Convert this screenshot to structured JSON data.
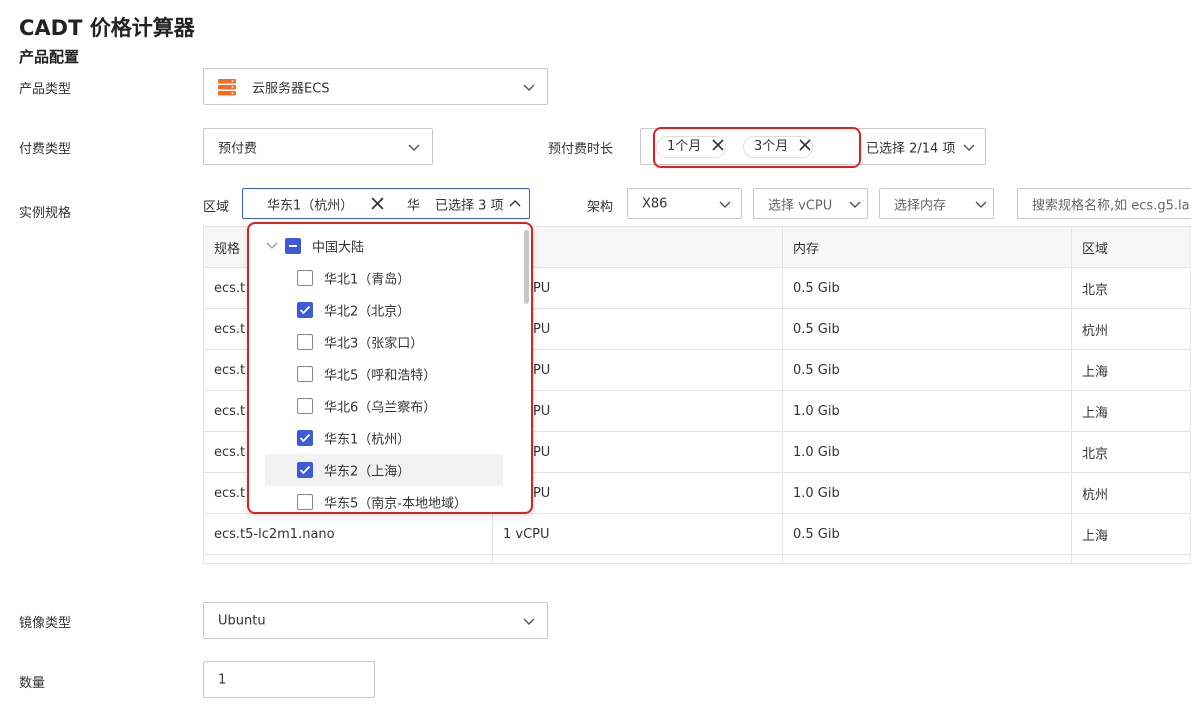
{
  "app_title": "CADT 价格计算器",
  "section_title": "产品配置",
  "product_type": {
    "label": "产品类型",
    "value": "云服务器ECS",
    "icon": "ecs-server-icon",
    "icon_color": "#f36d21"
  },
  "billing": {
    "label": "付费类型",
    "value": "预付费",
    "duration_label": "预付费时长",
    "tags": [
      "1个月",
      "3个月"
    ],
    "summary": "已选择 2/14 项"
  },
  "instance": {
    "label": "实例规格",
    "region_label": "区域",
    "region_tag": "华东1（杭州）",
    "region_tag_partial": "华",
    "region_summary": "已选择 3 项",
    "arch_label": "架构",
    "arch_value": "X86",
    "vcpu_placeholder": "选择 vCPU",
    "memory_placeholder": "选择内存",
    "search_placeholder": "搜索规格名称,如 ecs.g5.la"
  },
  "table": {
    "headers": [
      "规格",
      "",
      "内存",
      "区域"
    ],
    "rows": [
      [
        "ecs.t",
        "PU",
        "0.5 Gib",
        "北京"
      ],
      [
        "ecs.t",
        "PU",
        "0.5 Gib",
        "杭州"
      ],
      [
        "ecs.t",
        "PU",
        "0.5 Gib",
        "上海"
      ],
      [
        "ecs.t",
        "PU",
        "1.0 Gib",
        "上海"
      ],
      [
        "ecs.t",
        "PU",
        "1.0 Gib",
        "北京"
      ],
      [
        "ecs.t",
        "PU",
        "1.0 Gib",
        "杭州"
      ],
      [
        "ecs.t5-lc2m1.nano",
        "1 vCPU",
        "0.5 Gib",
        "上海"
      ]
    ]
  },
  "region_dropdown": {
    "group": "中国大陆",
    "items": [
      {
        "label": "华北1（青岛）",
        "checked": false
      },
      {
        "label": "华北2（北京）",
        "checked": true
      },
      {
        "label": "华北3（张家口）",
        "checked": false
      },
      {
        "label": "华北5（呼和浩特）",
        "checked": false
      },
      {
        "label": "华北6（乌兰察布）",
        "checked": false
      },
      {
        "label": "华东1（杭州）",
        "checked": true
      },
      {
        "label": "华东2（上海）",
        "checked": true
      },
      {
        "label": "华东5（南京-本地地域）",
        "checked": false
      }
    ]
  },
  "image": {
    "label": "镜像类型",
    "value": "Ubuntu"
  },
  "quantity": {
    "label": "数量",
    "value": "1"
  },
  "colors": {
    "accent": "#3b5bdb",
    "highlight": "#e02020"
  }
}
